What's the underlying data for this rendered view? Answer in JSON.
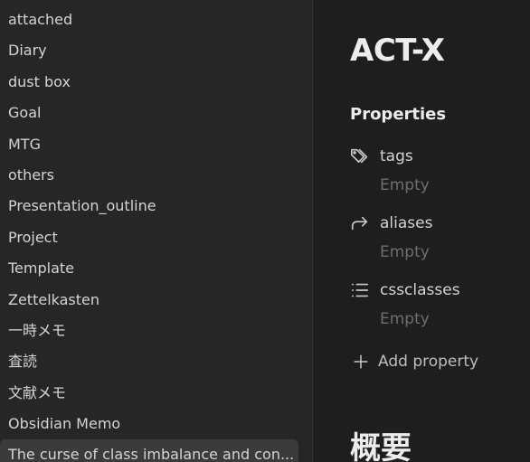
{
  "sidebar": {
    "items": [
      {
        "label": "attached"
      },
      {
        "label": "Diary"
      },
      {
        "label": "dust box"
      },
      {
        "label": "Goal"
      },
      {
        "label": "MTG"
      },
      {
        "label": "others"
      },
      {
        "label": "Presentation_outline"
      },
      {
        "label": "Project"
      },
      {
        "label": "Template"
      },
      {
        "label": "Zettelkasten"
      },
      {
        "label": "一時メモ"
      },
      {
        "label": "査読"
      },
      {
        "label": "文献メモ"
      },
      {
        "label": "Obsidian Memo"
      },
      {
        "label": "The curse of class imbalance and con..."
      }
    ]
  },
  "note": {
    "title": "ACT-X",
    "properties_heading": "Properties",
    "properties": [
      {
        "icon": "tags-icon",
        "key": "tags",
        "value": "Empty"
      },
      {
        "icon": "aliases-arrow-icon",
        "key": "aliases",
        "value": "Empty"
      },
      {
        "icon": "list-icon",
        "key": "cssclasses",
        "value": "Empty"
      }
    ],
    "add_property_label": "Add property",
    "section_heading": "概要"
  },
  "colors": {
    "sidebar_bg": "#262626",
    "main_bg": "#1e1e1e",
    "active_item_bg": "#3b3b3b",
    "text": "#d4d4d4",
    "muted": "#6e6e6e"
  }
}
